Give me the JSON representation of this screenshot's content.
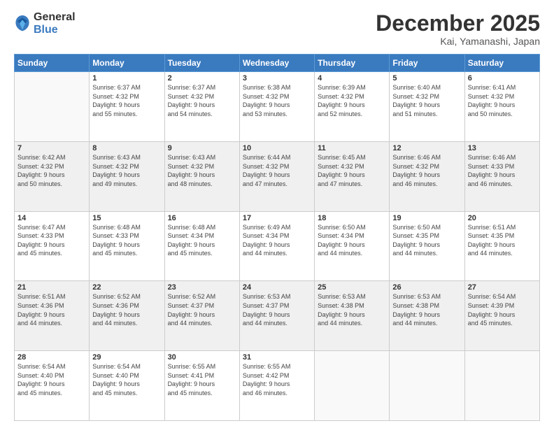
{
  "logo": {
    "general": "General",
    "blue": "Blue"
  },
  "header": {
    "month": "December 2025",
    "location": "Kai, Yamanashi, Japan"
  },
  "weekdays": [
    "Sunday",
    "Monday",
    "Tuesday",
    "Wednesday",
    "Thursday",
    "Friday",
    "Saturday"
  ],
  "weeks": [
    [
      {
        "day": "",
        "empty": true
      },
      {
        "day": "1",
        "sunrise": "6:37 AM",
        "sunset": "4:32 PM",
        "daylight": "9 hours and 55 minutes."
      },
      {
        "day": "2",
        "sunrise": "6:37 AM",
        "sunset": "4:32 PM",
        "daylight": "9 hours and 54 minutes."
      },
      {
        "day": "3",
        "sunrise": "6:38 AM",
        "sunset": "4:32 PM",
        "daylight": "9 hours and 53 minutes."
      },
      {
        "day": "4",
        "sunrise": "6:39 AM",
        "sunset": "4:32 PM",
        "daylight": "9 hours and 52 minutes."
      },
      {
        "day": "5",
        "sunrise": "6:40 AM",
        "sunset": "4:32 PM",
        "daylight": "9 hours and 51 minutes."
      },
      {
        "day": "6",
        "sunrise": "6:41 AM",
        "sunset": "4:32 PM",
        "daylight": "9 hours and 50 minutes."
      }
    ],
    [
      {
        "day": "7",
        "sunrise": "6:42 AM",
        "sunset": "4:32 PM",
        "daylight": "9 hours and 50 minutes."
      },
      {
        "day": "8",
        "sunrise": "6:43 AM",
        "sunset": "4:32 PM",
        "daylight": "9 hours and 49 minutes."
      },
      {
        "day": "9",
        "sunrise": "6:43 AM",
        "sunset": "4:32 PM",
        "daylight": "9 hours and 48 minutes."
      },
      {
        "day": "10",
        "sunrise": "6:44 AM",
        "sunset": "4:32 PM",
        "daylight": "9 hours and 47 minutes."
      },
      {
        "day": "11",
        "sunrise": "6:45 AM",
        "sunset": "4:32 PM",
        "daylight": "9 hours and 47 minutes."
      },
      {
        "day": "12",
        "sunrise": "6:46 AM",
        "sunset": "4:32 PM",
        "daylight": "9 hours and 46 minutes."
      },
      {
        "day": "13",
        "sunrise": "6:46 AM",
        "sunset": "4:33 PM",
        "daylight": "9 hours and 46 minutes."
      }
    ],
    [
      {
        "day": "14",
        "sunrise": "6:47 AM",
        "sunset": "4:33 PM",
        "daylight": "9 hours and 45 minutes."
      },
      {
        "day": "15",
        "sunrise": "6:48 AM",
        "sunset": "4:33 PM",
        "daylight": "9 hours and 45 minutes."
      },
      {
        "day": "16",
        "sunrise": "6:48 AM",
        "sunset": "4:34 PM",
        "daylight": "9 hours and 45 minutes."
      },
      {
        "day": "17",
        "sunrise": "6:49 AM",
        "sunset": "4:34 PM",
        "daylight": "9 hours and 44 minutes."
      },
      {
        "day": "18",
        "sunrise": "6:50 AM",
        "sunset": "4:34 PM",
        "daylight": "9 hours and 44 minutes."
      },
      {
        "day": "19",
        "sunrise": "6:50 AM",
        "sunset": "4:35 PM",
        "daylight": "9 hours and 44 minutes."
      },
      {
        "day": "20",
        "sunrise": "6:51 AM",
        "sunset": "4:35 PM",
        "daylight": "9 hours and 44 minutes."
      }
    ],
    [
      {
        "day": "21",
        "sunrise": "6:51 AM",
        "sunset": "4:36 PM",
        "daylight": "9 hours and 44 minutes."
      },
      {
        "day": "22",
        "sunrise": "6:52 AM",
        "sunset": "4:36 PM",
        "daylight": "9 hours and 44 minutes."
      },
      {
        "day": "23",
        "sunrise": "6:52 AM",
        "sunset": "4:37 PM",
        "daylight": "9 hours and 44 minutes."
      },
      {
        "day": "24",
        "sunrise": "6:53 AM",
        "sunset": "4:37 PM",
        "daylight": "9 hours and 44 minutes."
      },
      {
        "day": "25",
        "sunrise": "6:53 AM",
        "sunset": "4:38 PM",
        "daylight": "9 hours and 44 minutes."
      },
      {
        "day": "26",
        "sunrise": "6:53 AM",
        "sunset": "4:38 PM",
        "daylight": "9 hours and 44 minutes."
      },
      {
        "day": "27",
        "sunrise": "6:54 AM",
        "sunset": "4:39 PM",
        "daylight": "9 hours and 45 minutes."
      }
    ],
    [
      {
        "day": "28",
        "sunrise": "6:54 AM",
        "sunset": "4:40 PM",
        "daylight": "9 hours and 45 minutes."
      },
      {
        "day": "29",
        "sunrise": "6:54 AM",
        "sunset": "4:40 PM",
        "daylight": "9 hours and 45 minutes."
      },
      {
        "day": "30",
        "sunrise": "6:55 AM",
        "sunset": "4:41 PM",
        "daylight": "9 hours and 45 minutes."
      },
      {
        "day": "31",
        "sunrise": "6:55 AM",
        "sunset": "4:42 PM",
        "daylight": "9 hours and 46 minutes."
      },
      {
        "day": "",
        "empty": true
      },
      {
        "day": "",
        "empty": true
      },
      {
        "day": "",
        "empty": true
      }
    ]
  ],
  "labels": {
    "sunrise": "Sunrise:",
    "sunset": "Sunset:",
    "daylight": "Daylight:"
  }
}
